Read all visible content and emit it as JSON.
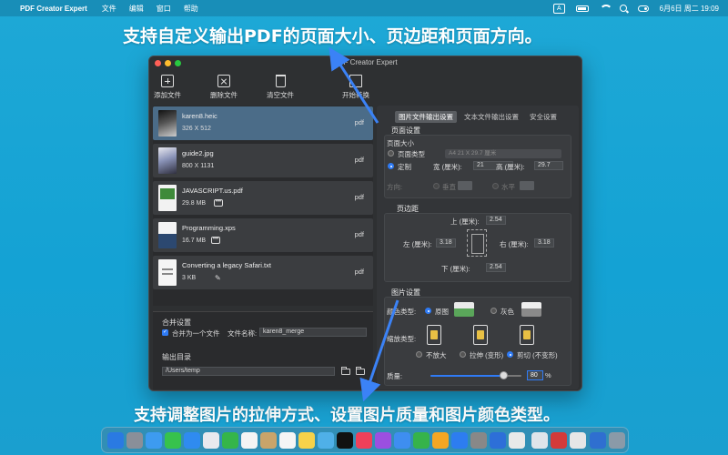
{
  "menubar": {
    "app_name": "PDF Creator Expert",
    "items": [
      "文件",
      "编辑",
      "窗口",
      "帮助"
    ],
    "input_indicator": "A",
    "clock": "6月6日 周二  19:09"
  },
  "captions": {
    "top": "支持自定义输出PDF的页面大小、页边距和页面方向。",
    "bottom": "支持调整图片的拉伸方式、设置图片质量和图片颜色类型。"
  },
  "window": {
    "title": "PDF Creator Expert",
    "toolbar": {
      "add": "添加文件",
      "delete": "删除文件",
      "clear": "清空文件",
      "convert": "开始转换"
    },
    "files": [
      {
        "name": "karen8.heic",
        "size": "326 X 512",
        "type": "pdf"
      },
      {
        "name": "guide2.jpg",
        "size": "800 X 1131",
        "type": "pdf"
      },
      {
        "name": "JAVASCRIPT.us.pdf",
        "size": "29.8 MB",
        "type": "pdf"
      },
      {
        "name": "Programming.xps",
        "size": "16.7 MB",
        "type": "pdf"
      },
      {
        "name": "Converting a legacy Safari.txt",
        "size": "3 KB",
        "type": "pdf"
      }
    ],
    "merge": {
      "section": "合并设置",
      "merge_checkbox": "合并为一个文件",
      "filename_label": "文件名称:",
      "filename_value": "karen8_merge"
    },
    "output": {
      "section": "输出目录",
      "path": "/Users/temp"
    },
    "tabs": [
      "图片文件输出设置",
      "文本文件输出设置",
      "安全设置"
    ],
    "page_settings": {
      "section": "页面设置",
      "size_label": "页面大小",
      "type_radio": "页面类型",
      "type_select": "A4 21 X 29.7 厘米",
      "custom_radio": "定制",
      "width_label": "宽 (厘米):",
      "width_value": "21",
      "height_label": "高 (厘米):",
      "height_value": "29.7",
      "orientation_label": "方向:",
      "portrait": "垂直",
      "landscape": "水平"
    },
    "margins": {
      "section": "页边距",
      "top_label": "上 (厘米):",
      "top_value": "2.54",
      "left_label": "左 (厘米):",
      "left_value": "3.18",
      "right_label": "右 (厘米):",
      "right_value": "3.18",
      "bottom_label": "下 (厘米):",
      "bottom_value": "2.54"
    },
    "image_settings": {
      "section": "图片设置",
      "color_label": "颜色类型:",
      "color_original": "原图",
      "color_gray": "灰色",
      "scale_label": "缩放类型:",
      "scale_none": "不放大",
      "scale_stretch": "拉伸 (变形)",
      "scale_crop": "剪切 (不变形)",
      "quality_label": "质量:",
      "quality_value": "80",
      "quality_unit": "%",
      "quality_level": 0.8
    }
  },
  "colors": {
    "accent": "#2f7bf5",
    "selected_row": "#4b6c88",
    "desktop": "#1ea8d6"
  }
}
